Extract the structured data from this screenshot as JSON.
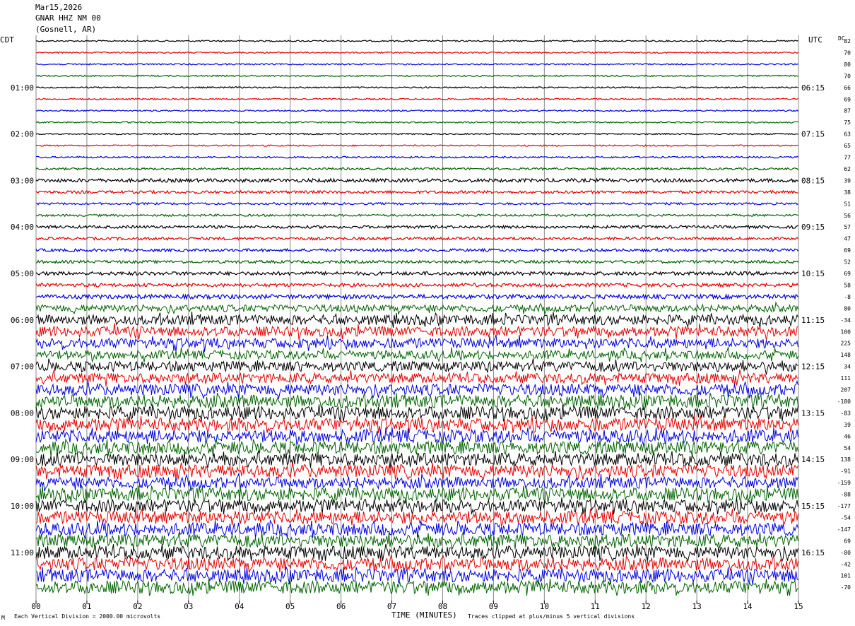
{
  "header": {
    "date": "Mar15,2026",
    "station": "GNAR HHZ NM 00",
    "location": "(Gosnell, AR)"
  },
  "left_timezone": "CDT",
  "right_timezone": "UTC",
  "dc_label": "DC",
  "footer": {
    "scale_note": "Each Vertical Division = 2000.00 microvolts",
    "xlabel": "TIME (MINUTES)",
    "clip_note": "Traces clipped at plus/minus 5 vertical divisions",
    "corner_mark": "M"
  },
  "chart_data": {
    "type": "line",
    "description_type": "helicorder",
    "xlabel": "TIME (MINUTES)",
    "x_ticks": [
      "00",
      "01",
      "02",
      "03",
      "04",
      "05",
      "06",
      "07",
      "08",
      "09",
      "10",
      "11",
      "12",
      "13",
      "14",
      "15"
    ],
    "xlim": [
      0,
      15
    ],
    "trace_colors": [
      "#000000",
      "#e60000",
      "#0000e0",
      "#006400"
    ],
    "left_time_labels": [
      "01:00",
      "02:00",
      "03:00",
      "04:00",
      "05:00",
      "06:00",
      "07:00",
      "08:00",
      "09:00",
      "10:00",
      "11:00"
    ],
    "right_time_labels": [
      "06:15",
      "07:15",
      "08:15",
      "09:15",
      "10:15",
      "11:15",
      "12:15",
      "13:15",
      "14:15",
      "15:15",
      "16:15"
    ],
    "dc_offsets": [
      "82",
      "70",
      "80",
      "70",
      "66",
      "69",
      "87",
      "75",
      "63",
      "65",
      "77",
      "62",
      "39",
      "38",
      "51",
      "56",
      "57",
      "47",
      "69",
      "52",
      "69",
      "58",
      "-8",
      "80",
      "-34",
      "100",
      "225",
      "148",
      "34",
      "111",
      "207",
      "-180",
      "-83",
      "39",
      "46",
      "54",
      "138",
      "-91",
      "-159",
      "-88",
      "-177",
      "-54",
      "-147",
      "69",
      "-80",
      "-42",
      "101",
      "-70"
    ],
    "trace_amplitude": [
      1,
      1,
      1,
      1,
      1,
      1,
      1,
      1,
      1,
      1,
      1.2,
      1.5,
      2.5,
      2,
      1.5,
      1.5,
      2,
      2,
      2,
      2,
      2.5,
      2.5,
      3,
      5,
      7,
      7,
      7,
      6,
      7,
      7,
      8,
      9,
      9,
      9,
      9,
      9,
      9,
      9,
      8,
      9,
      9,
      9,
      9,
      9,
      9,
      9,
      9,
      9
    ]
  }
}
